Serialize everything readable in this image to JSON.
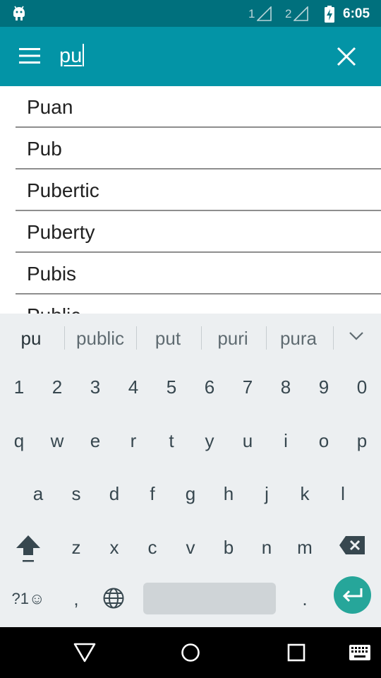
{
  "status_bar": {
    "sim1": "1",
    "sim2": "2",
    "time": "6:05",
    "icons": [
      "android-debug-icon",
      "signal-icon",
      "signal-icon",
      "battery-charging-icon"
    ]
  },
  "toolbar": {
    "search_value": "pu",
    "menu_icon": "menu-icon",
    "clear_icon": "close-icon"
  },
  "suggestions_list": {
    "items": [
      "Puan",
      "Pub",
      "Pubertic",
      "Puberty",
      "Pubis",
      "Public"
    ]
  },
  "keyboard": {
    "suggestions": [
      "pu",
      "public",
      "put",
      "puri",
      "pura"
    ],
    "number_row": [
      "1",
      "2",
      "3",
      "4",
      "5",
      "6",
      "7",
      "8",
      "9",
      "0"
    ],
    "row1": [
      "q",
      "w",
      "e",
      "r",
      "t",
      "y",
      "u",
      "i",
      "o",
      "p"
    ],
    "row2": [
      "a",
      "s",
      "d",
      "f",
      "g",
      "h",
      "j",
      "k",
      "l"
    ],
    "row3": [
      "z",
      "x",
      "c",
      "v",
      "b",
      "n",
      "m"
    ],
    "symbols_label": "?1☺",
    "comma": ",",
    "period": ".",
    "accent_color": "#26a69a"
  },
  "nav_bar": {
    "icons": [
      "back-icon",
      "home-icon",
      "recents-icon",
      "keyboard-icon"
    ]
  }
}
